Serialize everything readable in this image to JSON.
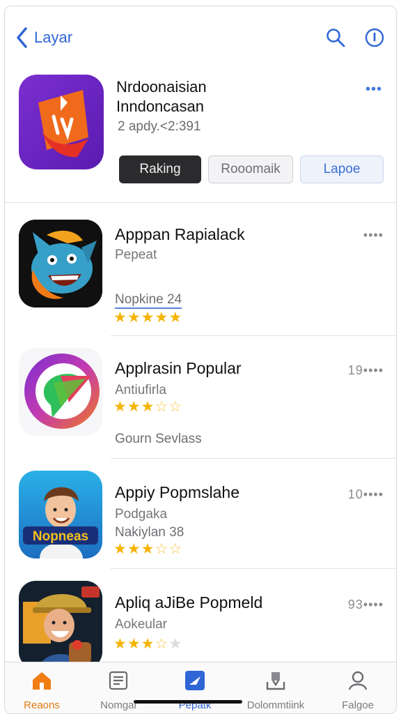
{
  "header": {
    "back_label": "Layar",
    "icons": [
      "search-icon",
      "info-icon"
    ]
  },
  "featured": {
    "title_line1": "Nrdoonaisian",
    "title_line2": "Inndoncasan",
    "subtitle": "2 apdy.<2:391",
    "more": "•••",
    "buttons": {
      "primary": "Raking",
      "secondary": "Rooomaik",
      "tertiary": "Lapoe"
    }
  },
  "apps": [
    {
      "title": "Apppan Rapialack",
      "subtitle": "Pepeat",
      "extra": "Nopkine 24",
      "meta": "••••",
      "rating": 5,
      "icon": "monster-game-icon"
    },
    {
      "title": "Applrasin Popular",
      "subtitle": "Antiufirla",
      "extra": "Gourn Sevlass",
      "meta": "19••••",
      "rating": 3.5,
      "icon": "chat-bubble-app-icon"
    },
    {
      "title": "Appiy Popmslahe",
      "subtitle": "Podgaka",
      "extra": "Nakiylan 38",
      "meta": "10••••",
      "rating": 3.5,
      "icon": "character-game-icon"
    },
    {
      "title": "Apliq aJiBe Popmeld",
      "subtitle": "Aokeular",
      "extra": "",
      "meta": "93••••",
      "rating": 3.5,
      "icon": "adventure-game-icon"
    }
  ],
  "tabs": [
    {
      "label": "Reaons",
      "icon": "home-icon"
    },
    {
      "label": "Nomgal",
      "icon": "news-icon"
    },
    {
      "label": "Pepatk",
      "icon": "apps-icon"
    },
    {
      "label": "Dolommtiink",
      "icon": "download-icon"
    },
    {
      "label": "Falgoe",
      "icon": "profile-icon"
    }
  ],
  "colors": {
    "accent_blue": "#2f66d5",
    "star": "#f5b301",
    "active_tab": "#e07a10"
  }
}
